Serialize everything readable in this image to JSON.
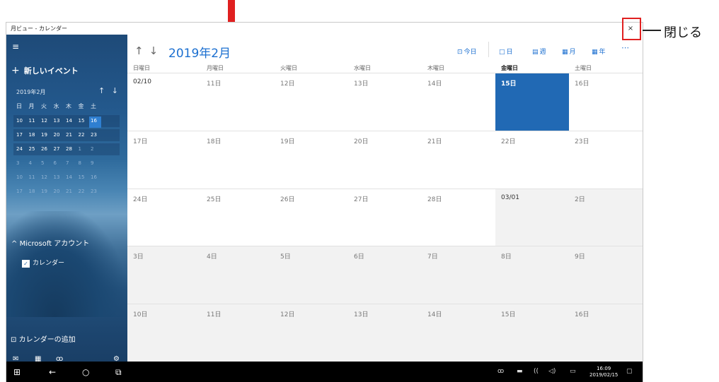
{
  "window": {
    "title": "月ビュー - カレンダー",
    "close_label": "×"
  },
  "sidebar": {
    "menu_icon": "≡",
    "new_event_plus": "+",
    "new_event": "新しいイベント",
    "mini_calendar": {
      "month": "2019年2月",
      "up": "↑",
      "down": "↓",
      "weekdays": [
        "日",
        "月",
        "火",
        "水",
        "木",
        "金",
        "土"
      ],
      "rows": [
        [
          "10",
          "11",
          "12",
          "13",
          "14",
          "15",
          "16"
        ],
        [
          "17",
          "18",
          "19",
          "20",
          "21",
          "22",
          "23"
        ],
        [
          "24",
          "25",
          "26",
          "27",
          "28",
          "1",
          "2"
        ],
        [
          "3",
          "4",
          "5",
          "6",
          "7",
          "8",
          "9"
        ],
        [
          "10",
          "11",
          "12",
          "13",
          "14",
          "15",
          "16"
        ],
        [
          "17",
          "18",
          "19",
          "20",
          "21",
          "22",
          "23"
        ]
      ]
    },
    "account_chevron": "^",
    "account": "Microsoft アカウント",
    "calendar_checkbox": "カレンダー",
    "check_mark": "✓",
    "add_calendar_icon": "⊡",
    "add_calendar": "カレンダーの追加",
    "bottom_icons": [
      "mail-icon",
      "calendar-icon",
      "people-icon",
      "settings-icon"
    ],
    "bottom_glyphs": [
      "✉",
      "▦",
      "ꝏ",
      "⚙"
    ]
  },
  "main": {
    "nav_up": "↑",
    "nav_down": "↓",
    "month_title": "2019年2月",
    "toolbar": {
      "today": "今日",
      "day": "日",
      "week": "週",
      "month": "月",
      "year": "年",
      "more": "⋯"
    },
    "toolbar_icons": {
      "today": "⊡",
      "day": "□",
      "week": "▤",
      "month": "▦",
      "year": "▦"
    },
    "weekdays": [
      "日曜日",
      "月曜日",
      "火曜日",
      "水曜日",
      "木曜日",
      "金曜日",
      "土曜日"
    ],
    "selected_weekday_index": 5,
    "weeks": [
      [
        "02/10",
        "11日",
        "12日",
        "13日",
        "14日",
        "15日",
        "16日"
      ],
      [
        "17日",
        "18日",
        "19日",
        "20日",
        "21日",
        "22日",
        "23日"
      ],
      [
        "24日",
        "25日",
        "26日",
        "27日",
        "28日",
        "03/01",
        "2日"
      ],
      [
        "3日",
        "4日",
        "5日",
        "6日",
        "7日",
        "8日",
        "9日"
      ],
      [
        "10日",
        "11日",
        "12日",
        "13日",
        "14日",
        "15日",
        "16日"
      ]
    ]
  },
  "taskbar": {
    "start_glyph": "⊞",
    "back_glyph": "←",
    "cortana_glyph": "○",
    "taskview_glyph": "⧉",
    "tray_glyphs": [
      "ꝏ",
      "▬",
      "((",
      "◁)",
      "▭"
    ],
    "time": "16:09",
    "date": "2019/02/15",
    "notification_glyph": "▢"
  },
  "annotation": {
    "close_callout": "閉じる",
    "accent": "#e02020"
  }
}
